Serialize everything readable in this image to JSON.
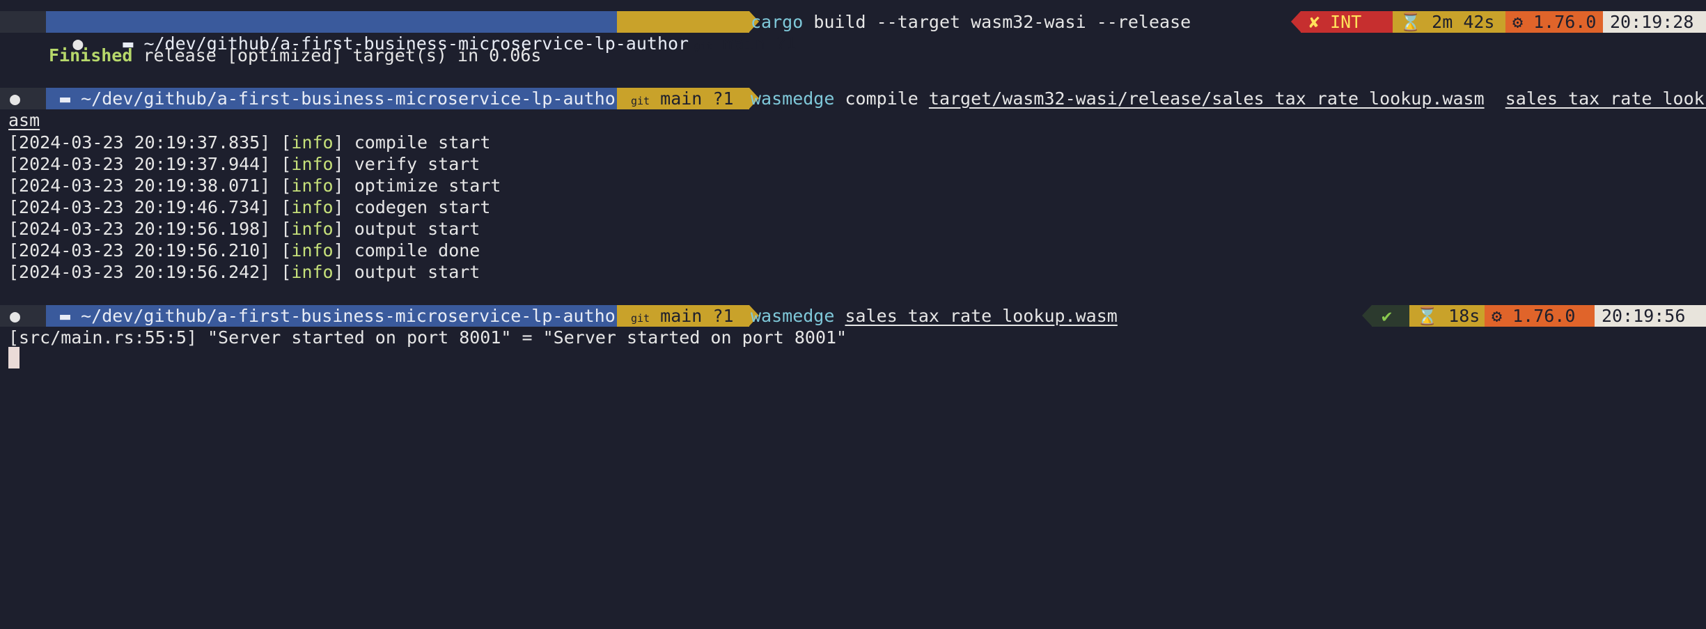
{
  "window": {
    "background": "#1d1f2d"
  },
  "prompt": {
    "os_icon": "apple-icon",
    "folder_icon": "folder-icon",
    "path": "~/dev/github/a-first-business-microservice-lp-author",
    "git_icon_label": "git",
    "branch": "main",
    "status": "?1",
    "colors": {
      "os_bg": "#2c2f3a",
      "dir_bg": "#3a5a9c",
      "git_bg": "#c9a22a"
    }
  },
  "blocks": [
    {
      "cmd_name": "cargo",
      "cmd_args": "build --target wasm32-wasi --release",
      "right": {
        "status": "✘ INT",
        "duration": "⌛ 2m 42s",
        "rust": "⚙ 1.76.0",
        "time": "20:19:28"
      },
      "output": {
        "finished_word": "Finished",
        "finished_rest": " release [optimized] target(s) in 0.06s"
      }
    },
    {
      "cmd_name": "wasmedge",
      "cmd_sub": "compile",
      "cmd_arg1": "target/wasm32-wasi/release/sales_tax_rate_lookup.wasm",
      "cmd_arg2_a": "sales_tax_rate_lookup.w",
      "cmd_arg2_b": "asm",
      "logs": [
        {
          "ts": "[2024-03-23 20:19:37.835]",
          "level": "info",
          "msg": " compile start"
        },
        {
          "ts": "[2024-03-23 20:19:37.944]",
          "level": "info",
          "msg": " verify start"
        },
        {
          "ts": "[2024-03-23 20:19:38.071]",
          "level": "info",
          "msg": " optimize start"
        },
        {
          "ts": "[2024-03-23 20:19:46.734]",
          "level": "info",
          "msg": " codegen start"
        },
        {
          "ts": "[2024-03-23 20:19:56.198]",
          "level": "info",
          "msg": " output start"
        },
        {
          "ts": "[2024-03-23 20:19:56.210]",
          "level": "info",
          "msg": " compile done"
        },
        {
          "ts": "[2024-03-23 20:19:56.242]",
          "level": "info",
          "msg": " output start"
        }
      ]
    },
    {
      "cmd_name": "wasmedge",
      "cmd_arg1": "sales_tax_rate_lookup.wasm",
      "right": {
        "status": "✔",
        "duration": "⌛ 18s",
        "rust": "⚙ 1.76.0",
        "time": "20:19:56"
      },
      "output": "[src/main.rs:55:5] \"Server started on port 8001\" = \"Server started on port 8001\""
    }
  ]
}
